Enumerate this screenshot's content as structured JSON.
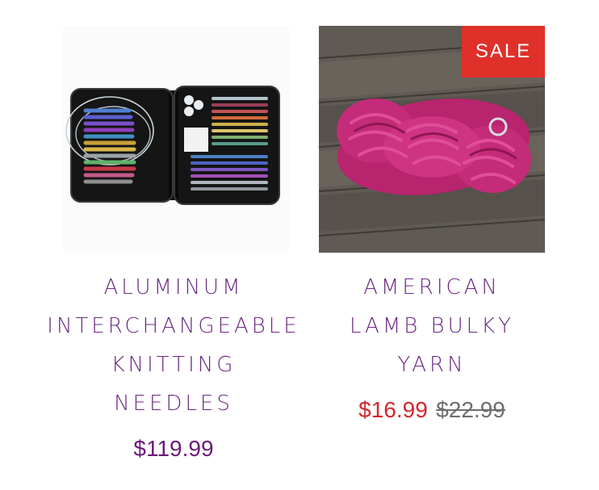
{
  "products": [
    {
      "title_lines": [
        "ALUMINUM",
        "INTERCHANGEABLE",
        "KNITTING",
        "NEEDLES"
      ],
      "price": "$119.99",
      "image": "knitting-needle-set-case"
    },
    {
      "title_lines": [
        "AMERICAN",
        "LAMB BULKY",
        "YARN"
      ],
      "sale_price": "$16.99",
      "compare_price": "$22.99",
      "badge": "SALE",
      "image": "magenta-yarn-skein-on-wood"
    }
  ],
  "colors": {
    "title": "#6b2a82",
    "price": "#6b1a7a",
    "sale_price": "#d7262b",
    "compare_price": "#6e6e6e",
    "badge_bg": "#e0302a"
  }
}
